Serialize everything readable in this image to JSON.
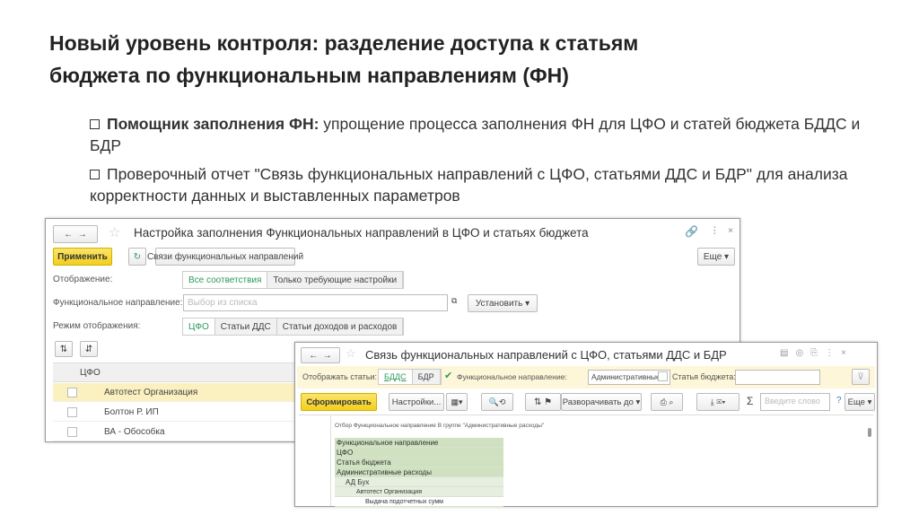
{
  "slide": {
    "title_line1": "Новый уровень контроля: разделение доступа к статьям",
    "title_line2": "бюджета по функциональным направлениям (ФН)",
    "bullets": [
      {
        "bold": "Помощник заполнения ФН:",
        "text": " упрощение процесса заполнения ФН для ЦФО и статей бюджета БДДС и БДР"
      },
      {
        "bold": "",
        "text": "Проверочный отчет \"Связь функциональных направлений с ЦФО, статьями ДДС и БДР\" для анализа корректности данных и выставленных параметров"
      }
    ]
  },
  "window1": {
    "title": "Настройка заполнения Функциональных направлений в ЦФО и статьях бюджета",
    "apply": "Применить",
    "links": "Связи функциональных направлений",
    "more": "Еще ▾",
    "display_label": "Отображение:",
    "display_options": [
      "Все соответствия",
      "Только требующие настройки"
    ],
    "fn_label": "Функциональное направление:",
    "fn_placeholder": "Выбор из списка",
    "set": "Установить ▾",
    "mode_label": "Режим отображения:",
    "mode_options": [
      "ЦФО",
      "Статьи ДДС",
      "Статьи доходов и расходов"
    ],
    "column": "ЦФО",
    "rows": [
      "Автотест Организация",
      "Болтон Р. ИП",
      "ВА - Обособка"
    ]
  },
  "window2": {
    "title": "Связь функциональных направлений с ЦФО, статьями ДДС и БДР",
    "show_label": "Отображать статьи:",
    "show_options": [
      "БДДС",
      "БДР"
    ],
    "fn_label": "Функциональное направление:",
    "fn_value": "Административные",
    "article_label": "Статья бюджета:",
    "generate": "Сформировать",
    "settings": "Настройки...",
    "expand": "Разворачивать до ▾",
    "search_placeholder": "Введите слово",
    "help": "?",
    "more": "Еще ▾",
    "filter": "Отбор   Функциональное направление В группе \"Административные расходы\"",
    "headers": [
      "Функциональное направление",
      "ЦФО",
      "Статья бюджета"
    ],
    "tree": [
      "Административные расходы",
      "АД Бух",
      "Автотест Организация",
      "Выдача подотчетных сумм"
    ]
  }
}
